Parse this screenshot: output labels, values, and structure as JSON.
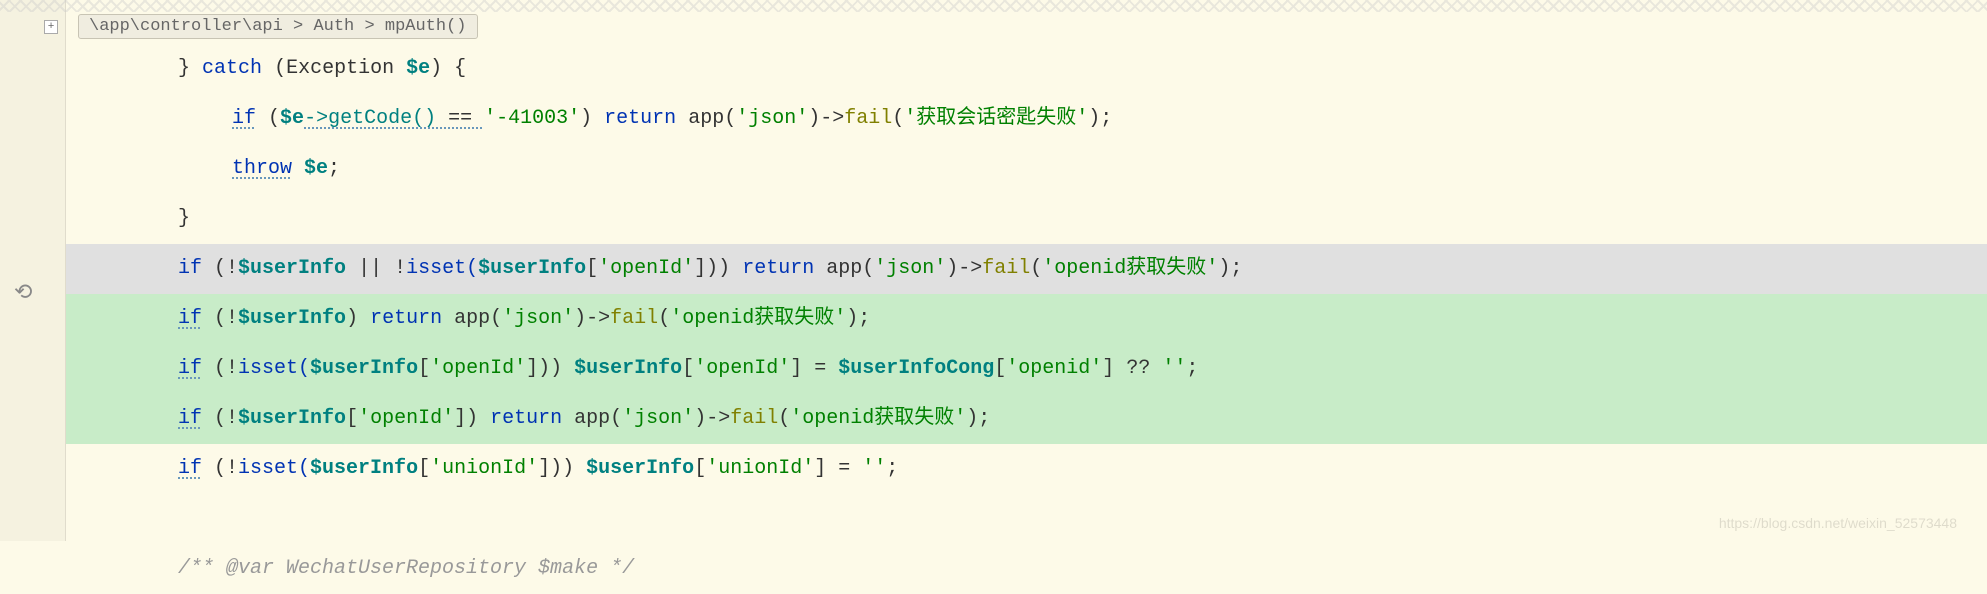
{
  "breadcrumb": {
    "path": "\\app\\controller\\api",
    "class": "Auth",
    "method": "mpAuth()"
  },
  "gutter": {
    "fold": "+",
    "undo": "⟲"
  },
  "code": {
    "line1_brace": "}",
    "line1_catch": "catch",
    "line1_paren_open": "(",
    "line1_exception": "Exception",
    "line1_e": "$e",
    "line1_paren_close": ")",
    "line1_brace_open": "{",
    "line2_if": "if",
    "line2_paren_open": "(",
    "line2_e": "$e",
    "line2_getcode": "->getCode()",
    "line2_eq": " == ",
    "line2_code": "'-41003'",
    "line2_paren_close": ")",
    "line2_return": "return",
    "line2_app": "app(",
    "line2_json": "'json'",
    "line2_close": ")->",
    "line2_fail": "fail",
    "line2_failopen": "(",
    "line2_failmsg": "'获取会话密匙失败'",
    "line2_failclose": ");",
    "line3_throw": "throw",
    "line3_e": "$e",
    "line3_semi": ";",
    "line4_brace": "}",
    "line5_if": "if",
    "line5_open": " (!",
    "line5_var": "$userInfo",
    "line5_or": " || !",
    "line5_isset": "isset(",
    "line5_var2": "$userInfo",
    "line5_key": "[",
    "line5_keystr": "'openId'",
    "line5_keyclose": "]))",
    "line5_return": "return",
    "line5_app": "app(",
    "line5_json": "'json'",
    "line5_close": ")->",
    "line5_fail": "fail",
    "line5_failopen": "(",
    "line5_failmsg": "'openid获取失败'",
    "line5_failclose": ");",
    "line6_if": "if",
    "line6_open": " (!",
    "line6_var": "$userInfo",
    "line6_close": ")",
    "line6_return": "return",
    "line6_app": "app(",
    "line6_json": "'json'",
    "line6_close2": ")->",
    "line6_fail": "fail",
    "line6_failopen": "(",
    "line6_failmsg": "'openid获取失败'",
    "line6_failclose": ");",
    "line7_if": "if",
    "line7_open": " (!",
    "line7_isset": "isset(",
    "line7_var": "$userInfo",
    "line7_key": "[",
    "line7_keystr": "'openId'",
    "line7_keyclose": "]))",
    "line7_var2": "$userInfo",
    "line7_key2": "[",
    "line7_keystr2": "'openId'",
    "line7_keyclose2": "]",
    "line7_eq": " = ",
    "line7_var3": "$userInfoCong",
    "line7_key3": "[",
    "line7_keystr3": "'openid'",
    "line7_keyclose3": "]",
    "line7_null": " ?? ",
    "line7_empty": "''",
    "line7_semi": ";",
    "line8_if": "if",
    "line8_open": " (!",
    "line8_var": "$userInfo",
    "line8_key": "[",
    "line8_keystr": "'openId'",
    "line8_keyclose": "])",
    "line8_return": "return",
    "line8_app": "app(",
    "line8_json": "'json'",
    "line8_close": ")->",
    "line8_fail": "fail",
    "line8_failopen": "(",
    "line8_failmsg": "'openid获取失败'",
    "line8_failclose": ");",
    "line9_if": "if",
    "line9_open": " (!",
    "line9_isset": "isset(",
    "line9_var": "$userInfo",
    "line9_key": "[",
    "line9_keystr": "'unionId'",
    "line9_keyclose": "]))",
    "line9_var2": "$userInfo",
    "line9_key2": "[",
    "line9_keystr2": "'unionId'",
    "line9_keyclose2": "]",
    "line9_eq": " = ",
    "line9_empty": "''",
    "line9_semi": ";",
    "line10_empty": "",
    "line11_comment": "/** @var WechatUserRepository $make */"
  },
  "watermark": "https://blog.csdn.net/weixin_52573448"
}
